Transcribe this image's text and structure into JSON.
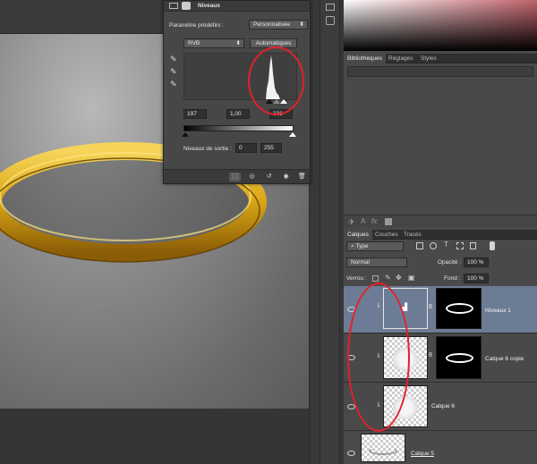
{
  "levels_panel": {
    "title": "Niveaux",
    "preset_label": "Paramètre prédéfini :",
    "preset_value": "Personnalisée",
    "channel": "RVB",
    "auto_button": "Automatiques",
    "input_black": "197",
    "input_gamma": "1,00",
    "input_white": "231",
    "output_label": "Niveaux de sortie :",
    "output_black": "0",
    "output_white": "255"
  },
  "libraries": {
    "tabs": [
      "Bibliothèques",
      "Réglages",
      "Styles"
    ]
  },
  "layers_panel": {
    "tabs": [
      "Calques",
      "Couches",
      "Tracés"
    ],
    "filter_kind": "Type",
    "blend_mode": "Normal",
    "opacity_label": "Opacité :",
    "opacity_value": "100 %",
    "lock_label": "Verrou :",
    "fill_label": "Fond :",
    "fill_value": "100 %",
    "layers": [
      {
        "name": "Niveaux 1",
        "selected": true
      },
      {
        "name": "Calque 6 copie",
        "selected": false
      },
      {
        "name": "Calque 6",
        "selected": false
      },
      {
        "name": "Calque 5",
        "selected": false
      }
    ]
  },
  "colors": {
    "annotation_red": "#e3202a",
    "selection_blue": "#6d7c95",
    "ring_gold": "#d9a514"
  }
}
